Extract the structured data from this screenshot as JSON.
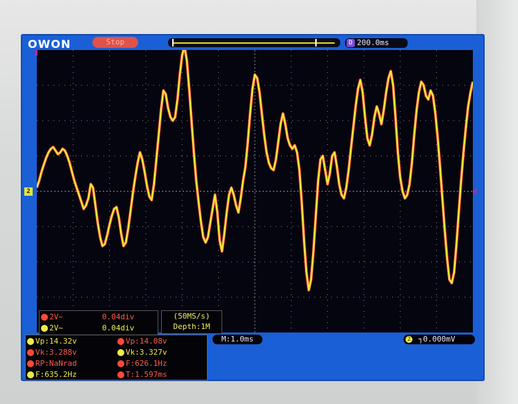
{
  "header": {
    "brand": "OWON",
    "run_state": "Stop",
    "timebase": "200.0ms",
    "timebase_badge": "D"
  },
  "waveform": {
    "channel_marker": "2",
    "colors": {
      "ch1": "#ff4a3a",
      "ch2": "#e8f03a",
      "grid": "#8a8a9a"
    },
    "samples": [
      0.1,
      0.3,
      0.55,
      0.75,
      0.95,
      1.1,
      1.2,
      1.25,
      1.15,
      1.05,
      1.1,
      1.2,
      1.15,
      1.0,
      0.8,
      0.55,
      0.3,
      0.1,
      -0.1,
      -0.3,
      -0.5,
      -0.4,
      -0.2,
      0.2,
      0.1,
      -0.4,
      -0.9,
      -1.3,
      -1.55,
      -1.5,
      -1.25,
      -0.95,
      -0.7,
      -0.5,
      -0.45,
      -0.75,
      -1.2,
      -1.55,
      -1.45,
      -1.05,
      -0.55,
      -0.05,
      0.4,
      0.8,
      1.1,
      0.9,
      0.55,
      0.15,
      -0.15,
      -0.25,
      0.2,
      0.9,
      1.6,
      2.3,
      2.85,
      2.75,
      2.35,
      2.1,
      2.0,
      2.1,
      2.6,
      3.3,
      3.85,
      4.1,
      3.7,
      2.9,
      2.0,
      1.1,
      0.3,
      -0.3,
      -0.85,
      -1.3,
      -1.45,
      -1.3,
      -0.9,
      -0.5,
      -0.1,
      -0.6,
      -1.4,
      -1.7,
      -1.2,
      -0.6,
      -0.1,
      0.1,
      -0.1,
      -0.4,
      -0.6,
      -0.2,
      0.3,
      0.7,
      1.4,
      2.2,
      2.9,
      3.3,
      3.2,
      2.8,
      2.2,
      1.6,
      1.1,
      0.8,
      0.65,
      0.6,
      0.9,
      1.4,
      1.9,
      2.2,
      1.9,
      1.5,
      1.3,
      1.2,
      1.3,
      1.1,
      0.6,
      -0.3,
      -1.4,
      -2.3,
      -2.8,
      -2.5,
      -1.7,
      -0.7,
      0.3,
      0.9,
      1.0,
      0.6,
      0.2,
      0.5,
      1.0,
      1.1,
      0.7,
      0.2,
      -0.1,
      -0.2,
      0.1,
      0.6,
      1.2,
      1.8,
      2.4,
      2.9,
      3.15,
      2.8,
      2.1,
      1.5,
      1.3,
      1.6,
      2.1,
      2.4,
      2.2,
      1.9,
      2.3,
      2.8,
      3.2,
      3.4,
      3.0,
      2.1,
      1.1,
      0.4,
      0.0,
      -0.2,
      -0.1,
      0.2,
      0.8,
      1.6,
      2.3,
      2.8,
      3.1,
      3.0,
      2.7,
      2.6,
      2.85,
      2.7,
      2.2,
      1.5,
      0.7,
      -0.2,
      -1.1,
      -1.9,
      -2.5,
      -2.6,
      -2.3,
      -1.5,
      -0.6,
      0.3,
      1.1,
      1.8,
      2.4,
      2.8,
      3.1
    ],
    "v_per_div_ratio": "2V"
  },
  "channels": [
    {
      "id": "1",
      "coupling": "2V~",
      "offset": "0.04div"
    },
    {
      "id": "2",
      "coupling": "2V~",
      "offset": "0.04div"
    }
  ],
  "sampling": {
    "rate": "(50MS/s)",
    "depth": "Depth:1M"
  },
  "measurements": [
    {
      "ch": "2",
      "text": "Vp:14.32v"
    },
    {
      "ch": "1",
      "text": "Vp:14.08v"
    },
    {
      "ch": "1",
      "text": "Vk:3.288v"
    },
    {
      "ch": "2",
      "text": "Vk:3.327v"
    },
    {
      "ch": "1",
      "text": "RP:NaNrad"
    },
    {
      "ch": "1",
      "text": "F:626.1Hz"
    },
    {
      "ch": "2",
      "text": "F:635.2Hz"
    },
    {
      "ch": "1",
      "text": "T:1.597ms"
    }
  ],
  "footer": {
    "mode": "M:1.0ms",
    "trigger_channel": "2",
    "trigger_level": "0.000mV"
  }
}
